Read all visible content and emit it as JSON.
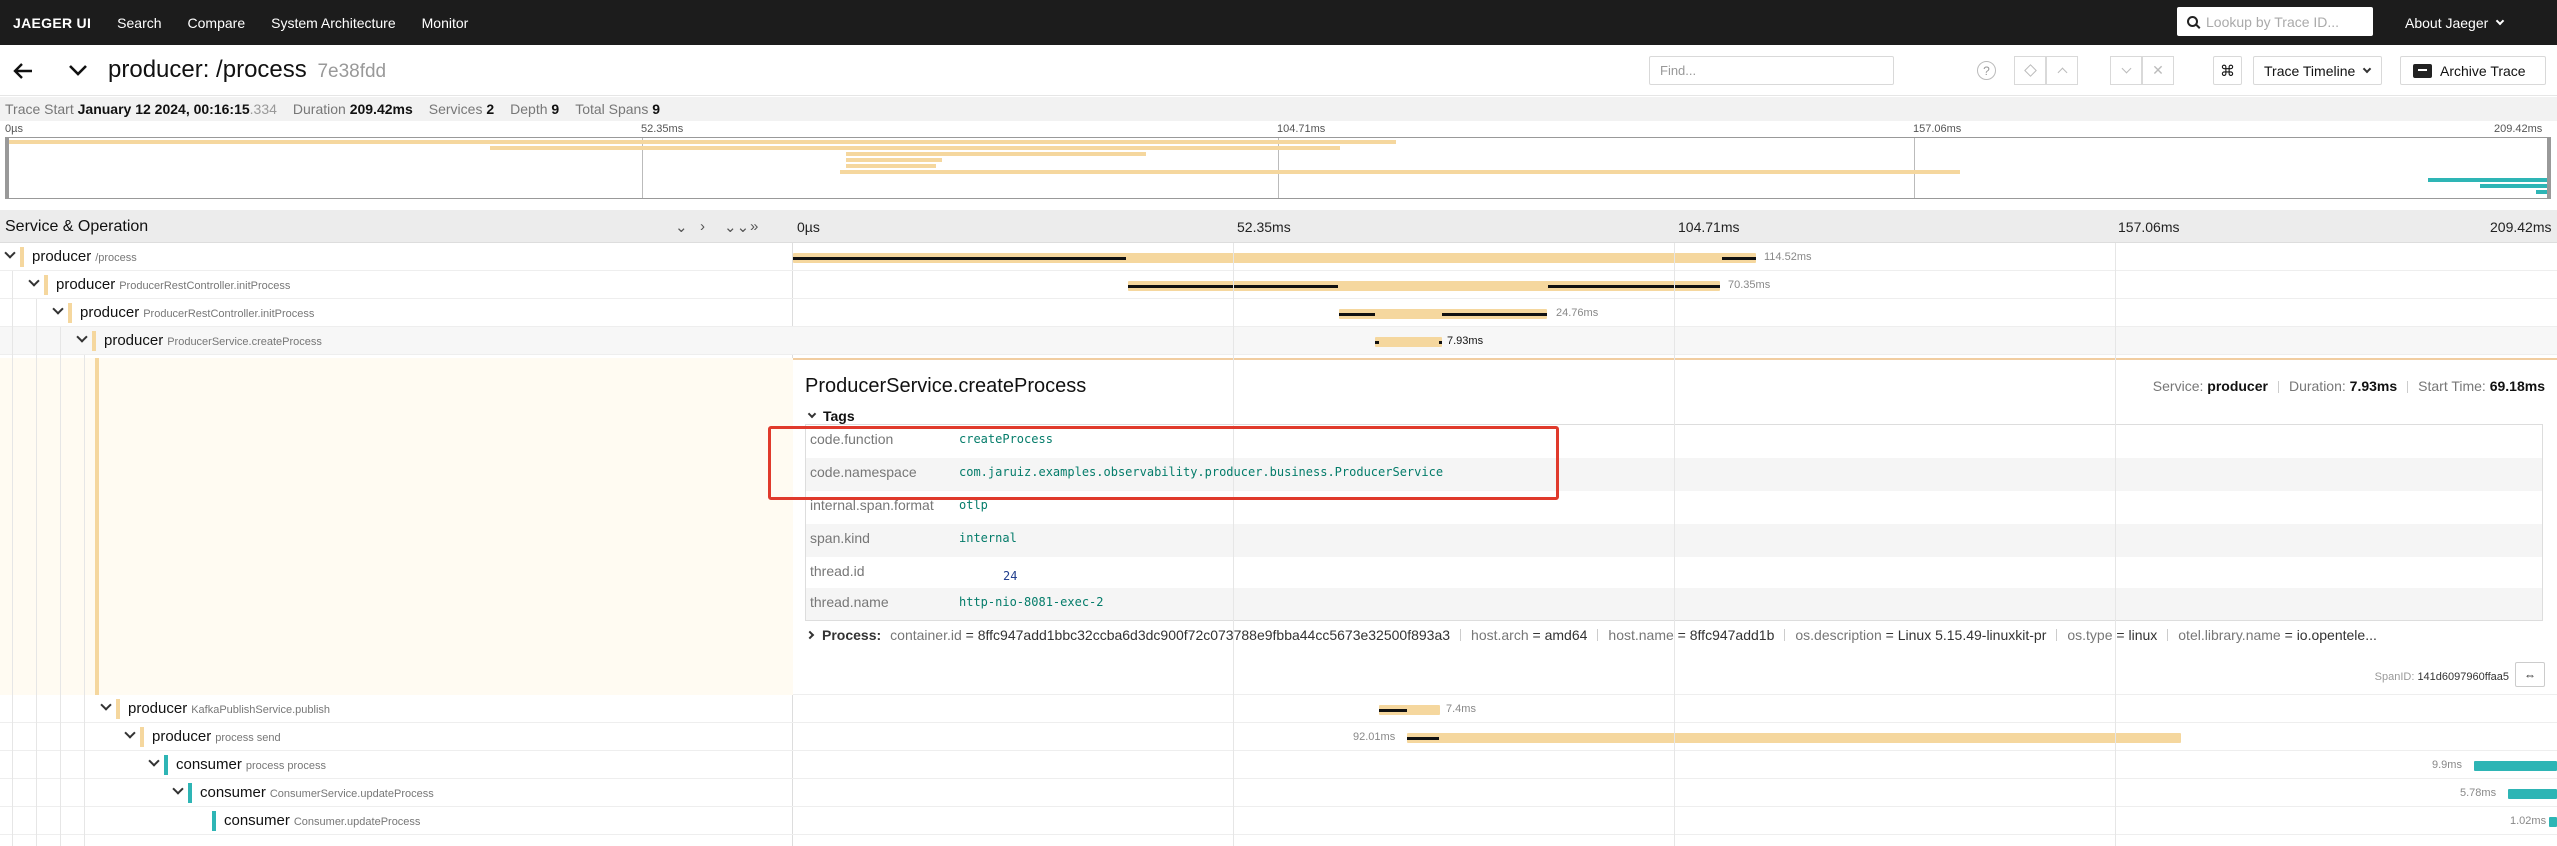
{
  "topbar": {
    "brand": "JAEGER UI",
    "nav": [
      "Search",
      "Compare",
      "System Architecture",
      "Monitor"
    ],
    "lookup_placeholder": "Lookup by Trace ID...",
    "about": "About Jaeger"
  },
  "header": {
    "title": "producer: /process",
    "trace_id": "7e38fdd",
    "find_placeholder": "Find...",
    "help_glyph": "?",
    "keyboard_glyph": "⌘",
    "view_select": "Trace Timeline",
    "archive": "Archive Trace"
  },
  "meta": {
    "trace_start_label": "Trace Start",
    "trace_start": "January 12 2024, 00:16:15",
    "trace_start_ms": ".334",
    "duration_label": "Duration",
    "duration": "209.42ms",
    "services_label": "Services",
    "services": "2",
    "depth_label": "Depth",
    "depth": "9",
    "spans_label": "Total Spans",
    "spans": "9"
  },
  "minimap_ticks": [
    "0µs",
    "52.35ms",
    "104.71ms",
    "157.06ms",
    "209.42ms"
  ],
  "table_ticks": [
    "0µs",
    "52.35ms",
    "104.71ms",
    "157.06ms",
    "209.42ms"
  ],
  "left_header": "Service & Operation",
  "header_controls": [
    "⌄",
    "›",
    "⌄⌄",
    "»"
  ],
  "colors": {
    "producer": "#f5d79e",
    "consumer": "#2eb5b5"
  },
  "spans": [
    {
      "service": "producer",
      "operation": "/process",
      "duration": "114.52ms"
    },
    {
      "service": "producer",
      "operation": "ProducerRestController.initProcess",
      "duration": "70.35ms"
    },
    {
      "service": "producer",
      "operation": "ProducerRestController.initProcess",
      "duration": "24.76ms"
    },
    {
      "service": "producer",
      "operation": "ProducerService.createProcess",
      "duration": "7.93ms"
    },
    {
      "service": "producer",
      "operation": "KafkaPublishService.publish",
      "duration": "7.4ms"
    },
    {
      "service": "producer",
      "operation": "process send",
      "duration": "92.01ms"
    },
    {
      "service": "consumer",
      "operation": "process process",
      "duration": "9.9ms"
    },
    {
      "service": "consumer",
      "operation": "ConsumerService.updateProcess",
      "duration": "5.78ms"
    },
    {
      "service": "consumer",
      "operation": "Consumer.updateProcess",
      "duration": "1.02ms"
    }
  ],
  "detail": {
    "title": "ProducerService.createProcess",
    "service_label": "Service:",
    "service": "producer",
    "duration_label": "Duration:",
    "duration": "7.93ms",
    "start_label": "Start Time:",
    "start": "69.18ms",
    "tags_label": "Tags",
    "tags": [
      {
        "key": "code.function",
        "value": "createProcess"
      },
      {
        "key": "code.namespace",
        "value": "com.jaruiz.examples.observability.producer.business.ProducerService"
      },
      {
        "key": "internal.span.format",
        "value": "otlp"
      },
      {
        "key": "span.kind",
        "value": "internal"
      },
      {
        "key": "thread.id",
        "value": "24"
      },
      {
        "key": "thread.name",
        "value": "http-nio-8081-exec-2"
      }
    ],
    "process_label": "Process:",
    "process": [
      {
        "key": "container.id",
        "value": "8ffc947add1bbc32ccba6d3dc900f72c073788e9fbba44cc5673e32500f893a3"
      },
      {
        "key": "host.arch",
        "value": "amd64"
      },
      {
        "key": "host.name",
        "value": "8ffc947add1b"
      },
      {
        "key": "os.description",
        "value": "Linux 5.15.49-linuxkit-pr"
      },
      {
        "key": "os.type",
        "value": "linux"
      },
      {
        "key": "otel.library.name",
        "value": "io.opentele..."
      }
    ],
    "spanid_label": "SpanID:",
    "spanid": "141d6097960ffaa5",
    "link_glyph": "⇔"
  }
}
